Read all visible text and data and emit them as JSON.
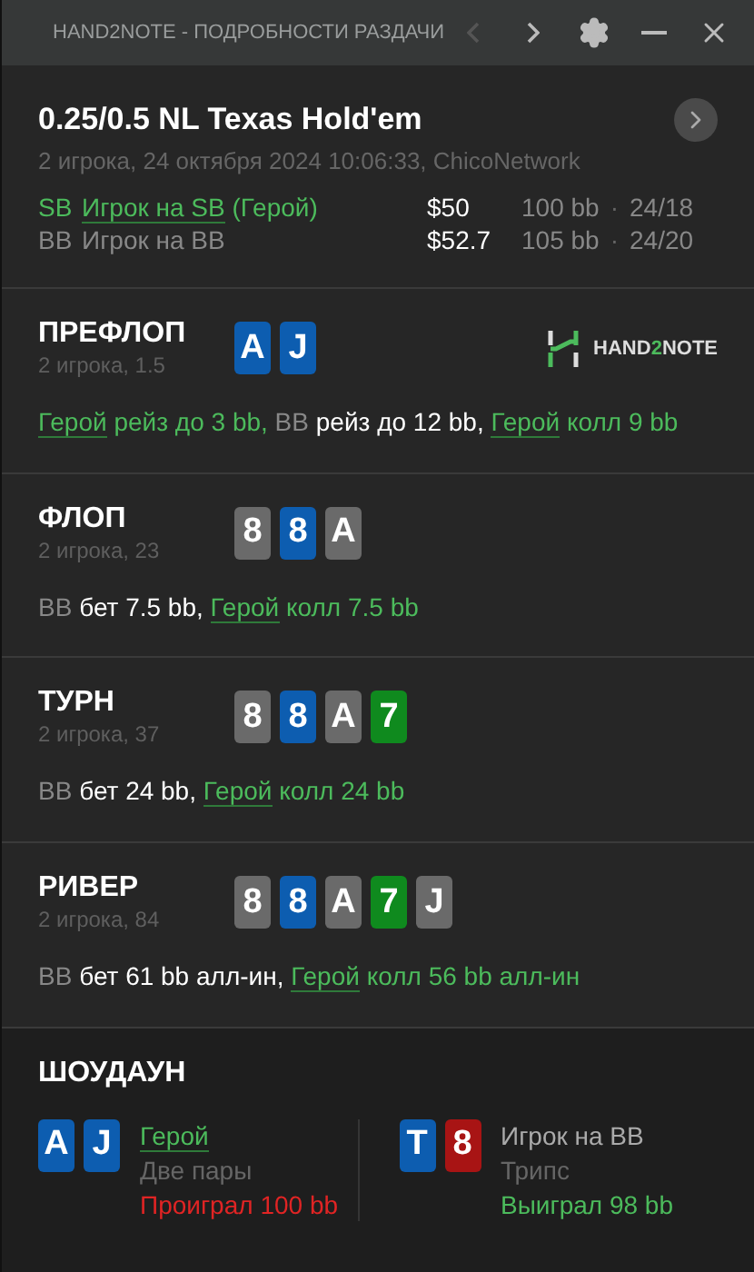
{
  "window": {
    "title": "HAND2NOTE - ПОДРОБНОСТИ РАЗДАЧИ",
    "prev_enabled": false,
    "next_enabled": true
  },
  "header": {
    "game": "0.25/0.5 NL Texas Hold'em",
    "info": "2 игрока, 24 октября 2024 10:06:33, ChicoNetwork",
    "players": [
      {
        "position": "SB",
        "name": "Игрок на SB",
        "suffix": "(Герой)",
        "hero": true,
        "stack": "$50",
        "bb": "100 bb",
        "sep": "·",
        "stats": "24/18"
      },
      {
        "position": "BB",
        "name": "Игрок на BB",
        "hero": false,
        "stack": "$52.7",
        "bb": "105 bb",
        "sep": "·",
        "stats": "24/20"
      }
    ]
  },
  "streets": [
    {
      "title": "ПРЕФЛОП",
      "info": "2 игрока, 1.5",
      "logo": {
        "parts": [
          "HAND",
          "2",
          "NOTE"
        ]
      },
      "cards": [
        {
          "rank": "A",
          "color": "#0d5db0"
        },
        {
          "rank": "J",
          "color": "#0d5db0"
        }
      ],
      "actions": [
        {
          "actor": "Герой",
          "text": "рейз до 3 bb,",
          "hero": true
        },
        {
          "actor": "BB",
          "text": "рейз до 12 bb,",
          "hero": false
        },
        {
          "actor": "Герой",
          "text": "колл 9 bb",
          "hero": true
        }
      ]
    },
    {
      "title": "ФЛОП",
      "info": "2 игрока, 23",
      "cards": [
        {
          "rank": "8",
          "color": "#6a6a6a"
        },
        {
          "rank": "8",
          "color": "#0d5db0"
        },
        {
          "rank": "A",
          "color": "#6a6a6a"
        }
      ],
      "actions": [
        {
          "actor": "BB",
          "text": "бет 7.5 bb,",
          "hero": false
        },
        {
          "actor": "Герой",
          "text": "колл 7.5 bb",
          "hero": true
        }
      ]
    },
    {
      "title": "ТУРН",
      "info": "2 игрока, 37",
      "cards": [
        {
          "rank": "8",
          "color": "#6a6a6a"
        },
        {
          "rank": "8",
          "color": "#0d5db0"
        },
        {
          "rank": "A",
          "color": "#6a6a6a"
        },
        {
          "rank": "7",
          "color": "#0f8a1e"
        }
      ],
      "actions": [
        {
          "actor": "BB",
          "text": "бет 24 bb,",
          "hero": false
        },
        {
          "actor": "Герой",
          "text": "колл 24 bb",
          "hero": true
        }
      ]
    },
    {
      "title": "РИВЕР",
      "info": "2 игрока, 84",
      "cards": [
        {
          "rank": "8",
          "color": "#6a6a6a"
        },
        {
          "rank": "8",
          "color": "#0d5db0"
        },
        {
          "rank": "A",
          "color": "#6a6a6a"
        },
        {
          "rank": "7",
          "color": "#0f8a1e"
        },
        {
          "rank": "J",
          "color": "#6a6a6a"
        }
      ],
      "actions": [
        {
          "actor": "BB",
          "text": "бет 61 bb алл-ин,",
          "hero": false
        },
        {
          "actor": "Герой",
          "text": "колл 56 bb алл-ин",
          "hero": true
        }
      ]
    }
  ],
  "showdown": {
    "title": "ШОУДАУН",
    "players": [
      {
        "name": "Герой",
        "hero": true,
        "hand": "Две пары",
        "result": "Проиграл 100 bb",
        "won": false,
        "cards": [
          {
            "rank": "A",
            "color": "#0d5db0"
          },
          {
            "rank": "J",
            "color": "#0d5db0"
          }
        ]
      },
      {
        "name": "Игрок на BB",
        "hero": false,
        "hand": "Трипс",
        "result": "Выиграл 98 bb",
        "won": true,
        "cards": [
          {
            "rank": "T",
            "color": "#0d5db0"
          },
          {
            "rank": "8",
            "color": "#a81414"
          }
        ]
      }
    ]
  }
}
